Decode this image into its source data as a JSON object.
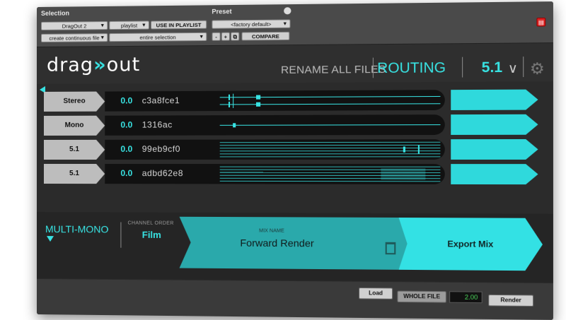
{
  "selection": {
    "label": "Selection",
    "plugin": "DragOut 2",
    "playlist": "playlist",
    "use_in_playlist": "USE IN PLAYLIST",
    "mode": "create continuous file",
    "scope": "entire selection"
  },
  "preset": {
    "label": "Preset",
    "factory": "<factory default>",
    "minus": "-",
    "plus": "+",
    "compare": "COMPARE"
  },
  "header": {
    "logo_left": "drag",
    "logo_chevrons": "»",
    "logo_right": "out",
    "rename_all": "RENAME ALL FILES",
    "routing": "ROUTING",
    "channel_format": "5.1",
    "chevron": "∨",
    "gear": "⚙"
  },
  "tracks": [
    {
      "type": "Stereo",
      "gain": "0.0",
      "name": "c3a8fce1"
    },
    {
      "type": "Mono",
      "gain": "0.0",
      "name": "1316ac"
    },
    {
      "type": "5.1",
      "gain": "0.0",
      "name": "99eb9cf0"
    },
    {
      "type": "5.1",
      "gain": "0.0",
      "name": "adbd62e8"
    }
  ],
  "output_mode": {
    "label": "MULTI-MONO"
  },
  "channel_order": {
    "label": "CHANNEL ORDER",
    "value": "Film"
  },
  "mix_name": {
    "label": "MIX NAME",
    "value": "Forward Render"
  },
  "export": {
    "label": "Export Mix"
  },
  "footer": {
    "load": "Load",
    "whole_file": "WHOLE FILE",
    "speed": "2.00",
    "render": "Render"
  },
  "colors": {
    "accent": "#38e3e3",
    "panel": "#2b2b2b"
  },
  "icons": [
    "settings-icon",
    "trash-icon",
    "collapse-arrow-icon",
    "dropdown-arrow-icon"
  ]
}
